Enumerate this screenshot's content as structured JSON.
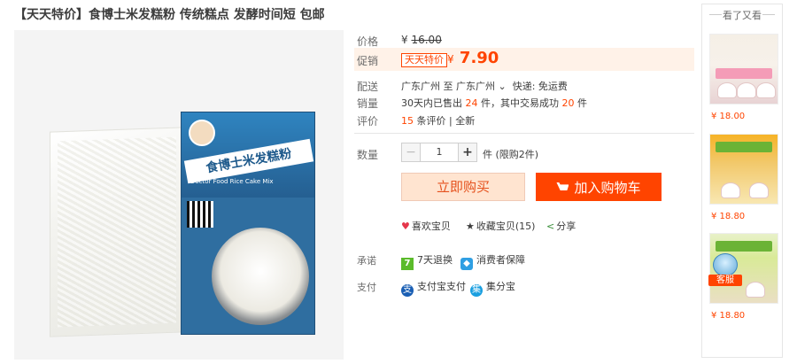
{
  "title": {
    "tag": "【天天特价】",
    "name": "食博士米发糕粉 传统糕点 发酵时间短 包邮"
  },
  "product_image": {
    "box_name": "食博士米发糕粉",
    "box_sub": "Doctor Food Rice Cake Mix"
  },
  "price": {
    "label": "价格",
    "currency": "¥",
    "original": "16.00",
    "promo_label": "促销",
    "promo_tag": "天天特价",
    "current": "7.90"
  },
  "delivery": {
    "label": "配送",
    "text": "广东广州 至 广东广州",
    "express": "快递: 免运费"
  },
  "sales": {
    "label": "销量",
    "prefix": "30天内已售出",
    "sold": "24",
    "mid": "件，其中交易成功",
    "success": "20",
    "suffix": "件"
  },
  "rating": {
    "label": "评价",
    "count": "15",
    "text": "条评价 | 全新"
  },
  "quantity": {
    "label": "数量",
    "minus": "−",
    "value": "1",
    "plus": "+",
    "unit": "件 (限购2件)"
  },
  "buttons": {
    "buy": "立即购买",
    "cart": "加入购物车"
  },
  "actions": {
    "like": "喜欢宝贝",
    "collect": "收藏宝贝(15)",
    "share": "分享"
  },
  "service": {
    "label": "承诺",
    "return": "7天退换",
    "return_icon": "7",
    "secure": "消费者保障"
  },
  "payment": {
    "label": "支付",
    "alipay": "支付宝支付",
    "jfb": "集分宝"
  },
  "sidebar": {
    "title": "看了又看",
    "items": [
      {
        "price": "¥ 18.00"
      },
      {
        "price": "¥ 18.80"
      },
      {
        "price": "¥ 18.80"
      }
    ]
  },
  "kefu": {
    "label": "客服"
  },
  "colors": {
    "accent": "#ff4400",
    "buy_bg": "#ffe4d0"
  }
}
